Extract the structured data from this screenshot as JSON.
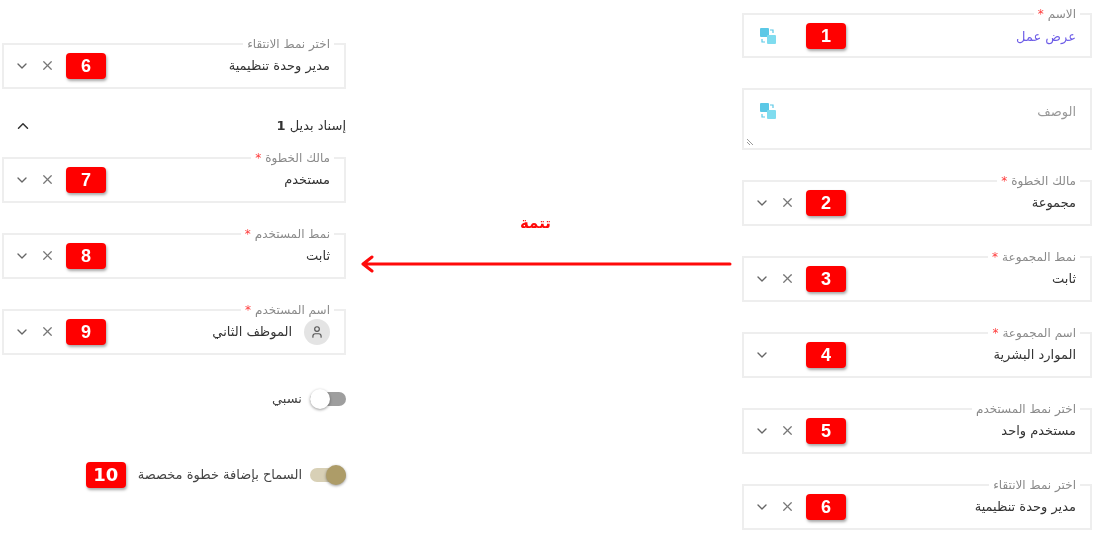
{
  "right_form": {
    "fields": [
      {
        "kind": "text",
        "label": "الاسم",
        "required_mark": "*",
        "value": "عرض عمل",
        "translatable": true,
        "badge": "1"
      },
      {
        "kind": "textarea",
        "placeholder": "الوصف",
        "translatable": true
      },
      {
        "kind": "select",
        "label": "مالك الخطوة",
        "required_mark": "*",
        "value": "مجموعة",
        "clearable": true,
        "badge": "2"
      },
      {
        "kind": "select",
        "label": "نمط المجموعة",
        "required_mark": "*",
        "value": "ثابت",
        "clearable": true,
        "badge": "3"
      },
      {
        "kind": "select",
        "label": "اسم المجموعة",
        "required_mark": "*",
        "value": "الموارد البشرية",
        "clearable": false,
        "badge": "4"
      },
      {
        "kind": "select",
        "label": "اختر نمط المستخدم",
        "value": "مستخدم واحد",
        "clearable": true,
        "badge": "5"
      },
      {
        "kind": "select",
        "label": "اختر نمط الانتقاء",
        "value": "مدير وحدة تنظيمية",
        "clearable": true,
        "badge": "6"
      }
    ]
  },
  "annotation": {
    "label": "تتمة"
  },
  "left_form": {
    "fields": [
      {
        "kind": "select",
        "label": "اختر نمط الانتقاء",
        "value": "مدير وحدة تنظيمية",
        "clearable": true,
        "badge": "6"
      }
    ],
    "section": {
      "title": "إسناد بديل **1**",
      "expanded": true
    },
    "section_fields": [
      {
        "kind": "select",
        "label": "مالك الخطوة",
        "required_mark": "*",
        "value": "مستخدم",
        "clearable": true,
        "badge": "7"
      },
      {
        "kind": "select",
        "label": "نمط المستخدم",
        "required_mark": "*",
        "value": "ثابت",
        "clearable": true,
        "badge": "8"
      },
      {
        "kind": "select",
        "label": "اسم المستخدم",
        "required_mark": "*",
        "value": "الموظف الثاني",
        "clearable": true,
        "avatar": true,
        "badge": "9"
      }
    ],
    "toggles": [
      {
        "label": "نسبي",
        "on": false
      },
      {
        "label": "السماح بإضافة خطوة مخصصة",
        "on": true,
        "badge": "10"
      }
    ]
  }
}
